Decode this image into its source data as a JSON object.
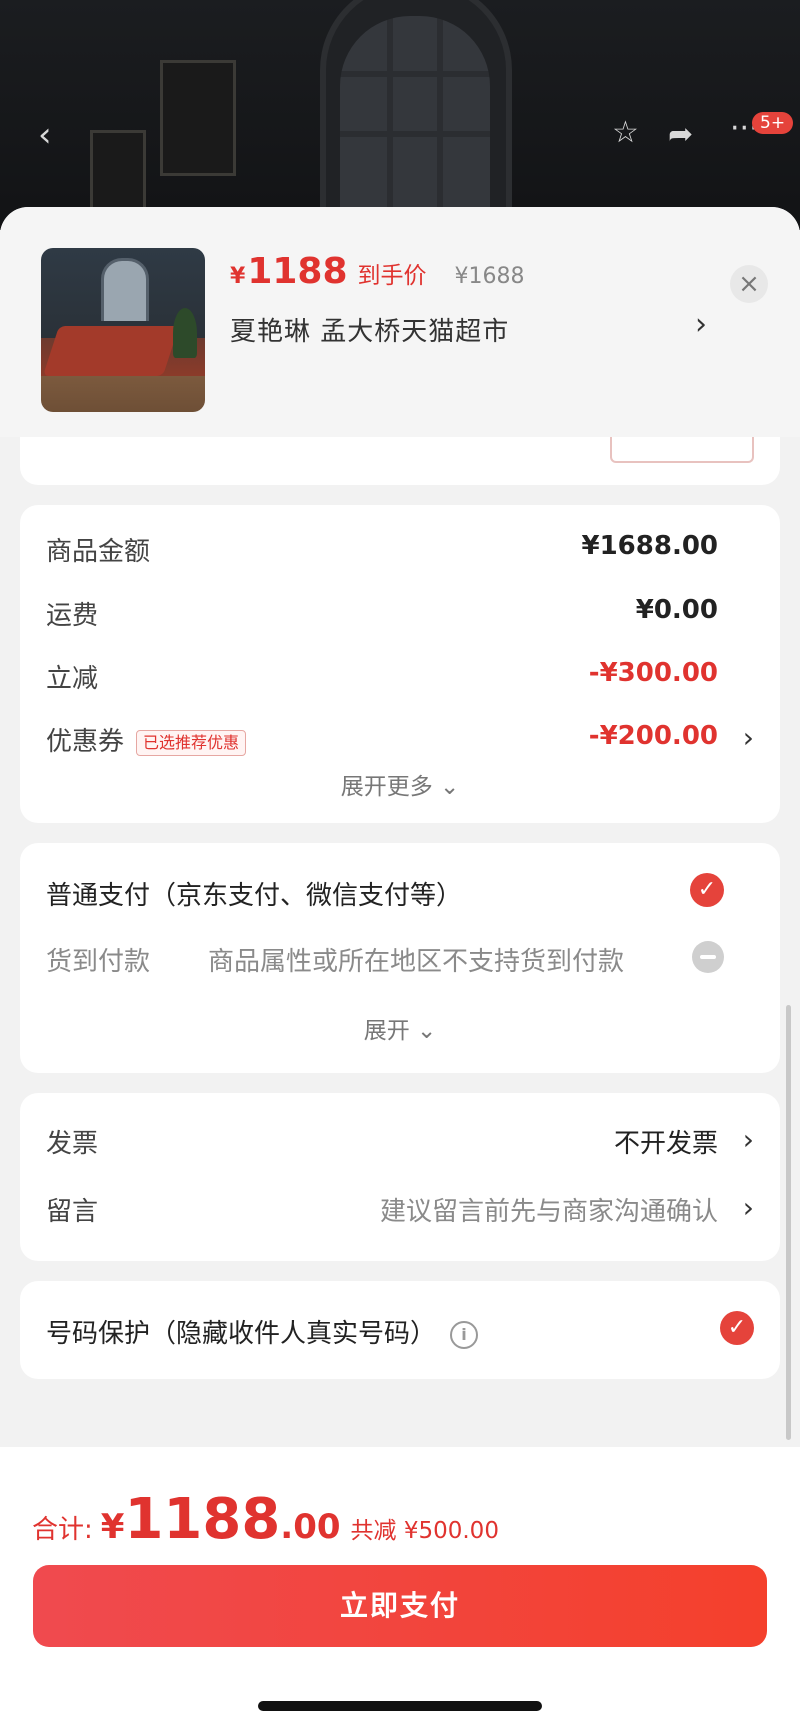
{
  "topbar": {
    "back_icon": "chevron-left-icon",
    "icons": [
      "star-icon",
      "share-icon",
      "more-icon"
    ],
    "badge": "5+"
  },
  "product": {
    "price_currency": "¥",
    "price": "1188",
    "price_tag": "到手价",
    "original_price": "¥1688",
    "shop": "夏艳琳  孟大桥天猫超市",
    "close": "×",
    "arrow": "›"
  },
  "summary": {
    "rows": [
      {
        "label": "商品金额",
        "value": "¥1688.00"
      },
      {
        "label": "运费",
        "value": "¥0.00"
      },
      {
        "label": "立减",
        "value": "-¥300.00"
      },
      {
        "label": "优惠券",
        "tag": "已选推荐优惠",
        "value": "-¥200.00"
      }
    ],
    "expand_more": "展开更多 ⌄"
  },
  "payment": {
    "normal": "普通支付（京东支付、微信支付等）",
    "cod_label": "货到付款",
    "cod_note": "商品属性或所在地区不支持货到付款",
    "expand": "展开 ⌄"
  },
  "invoice": {
    "label": "发票",
    "value": "不开发票"
  },
  "message": {
    "label": "留言",
    "placeholder": "建议留言前先与商家沟通确认"
  },
  "privacy": {
    "label": "号码保护（隐藏收件人真实号码）",
    "info": "i"
  },
  "footer": {
    "total_label": "合计:",
    "currency": "¥",
    "total_int": "1188",
    "total_dec": ".00",
    "savings": "共减 ¥500.00",
    "pay_button": "立即支付"
  },
  "colors": {
    "accent": "#e0332f",
    "check": "#e5433b"
  }
}
